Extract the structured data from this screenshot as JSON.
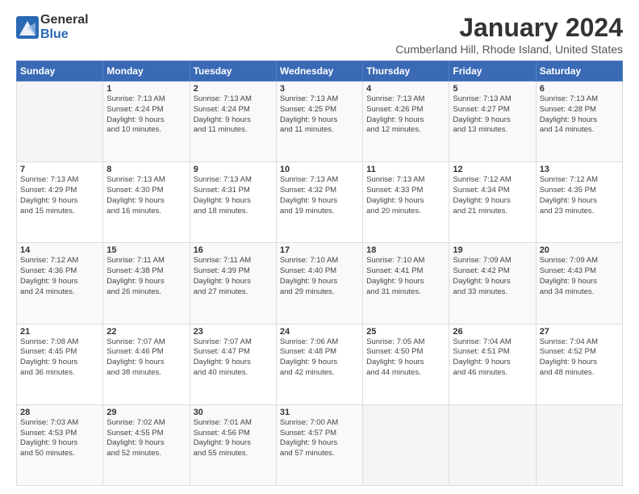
{
  "logo": {
    "general": "General",
    "blue": "Blue"
  },
  "header": {
    "title": "January 2024",
    "location": "Cumberland Hill, Rhode Island, United States"
  },
  "weekdays": [
    "Sunday",
    "Monday",
    "Tuesday",
    "Wednesday",
    "Thursday",
    "Friday",
    "Saturday"
  ],
  "weeks": [
    [
      {
        "day": "",
        "content": ""
      },
      {
        "day": "1",
        "content": "Sunrise: 7:13 AM\nSunset: 4:24 PM\nDaylight: 9 hours\nand 10 minutes."
      },
      {
        "day": "2",
        "content": "Sunrise: 7:13 AM\nSunset: 4:24 PM\nDaylight: 9 hours\nand 11 minutes."
      },
      {
        "day": "3",
        "content": "Sunrise: 7:13 AM\nSunset: 4:25 PM\nDaylight: 9 hours\nand 11 minutes."
      },
      {
        "day": "4",
        "content": "Sunrise: 7:13 AM\nSunset: 4:26 PM\nDaylight: 9 hours\nand 12 minutes."
      },
      {
        "day": "5",
        "content": "Sunrise: 7:13 AM\nSunset: 4:27 PM\nDaylight: 9 hours\nand 13 minutes."
      },
      {
        "day": "6",
        "content": "Sunrise: 7:13 AM\nSunset: 4:28 PM\nDaylight: 9 hours\nand 14 minutes."
      }
    ],
    [
      {
        "day": "7",
        "content": "Sunrise: 7:13 AM\nSunset: 4:29 PM\nDaylight: 9 hours\nand 15 minutes."
      },
      {
        "day": "8",
        "content": "Sunrise: 7:13 AM\nSunset: 4:30 PM\nDaylight: 9 hours\nand 16 minutes."
      },
      {
        "day": "9",
        "content": "Sunrise: 7:13 AM\nSunset: 4:31 PM\nDaylight: 9 hours\nand 18 minutes."
      },
      {
        "day": "10",
        "content": "Sunrise: 7:13 AM\nSunset: 4:32 PM\nDaylight: 9 hours\nand 19 minutes."
      },
      {
        "day": "11",
        "content": "Sunrise: 7:13 AM\nSunset: 4:33 PM\nDaylight: 9 hours\nand 20 minutes."
      },
      {
        "day": "12",
        "content": "Sunrise: 7:12 AM\nSunset: 4:34 PM\nDaylight: 9 hours\nand 21 minutes."
      },
      {
        "day": "13",
        "content": "Sunrise: 7:12 AM\nSunset: 4:35 PM\nDaylight: 9 hours\nand 23 minutes."
      }
    ],
    [
      {
        "day": "14",
        "content": "Sunrise: 7:12 AM\nSunset: 4:36 PM\nDaylight: 9 hours\nand 24 minutes."
      },
      {
        "day": "15",
        "content": "Sunrise: 7:11 AM\nSunset: 4:38 PM\nDaylight: 9 hours\nand 26 minutes."
      },
      {
        "day": "16",
        "content": "Sunrise: 7:11 AM\nSunset: 4:39 PM\nDaylight: 9 hours\nand 27 minutes."
      },
      {
        "day": "17",
        "content": "Sunrise: 7:10 AM\nSunset: 4:40 PM\nDaylight: 9 hours\nand 29 minutes."
      },
      {
        "day": "18",
        "content": "Sunrise: 7:10 AM\nSunset: 4:41 PM\nDaylight: 9 hours\nand 31 minutes."
      },
      {
        "day": "19",
        "content": "Sunrise: 7:09 AM\nSunset: 4:42 PM\nDaylight: 9 hours\nand 33 minutes."
      },
      {
        "day": "20",
        "content": "Sunrise: 7:09 AM\nSunset: 4:43 PM\nDaylight: 9 hours\nand 34 minutes."
      }
    ],
    [
      {
        "day": "21",
        "content": "Sunrise: 7:08 AM\nSunset: 4:45 PM\nDaylight: 9 hours\nand 36 minutes."
      },
      {
        "day": "22",
        "content": "Sunrise: 7:07 AM\nSunset: 4:46 PM\nDaylight: 9 hours\nand 38 minutes."
      },
      {
        "day": "23",
        "content": "Sunrise: 7:07 AM\nSunset: 4:47 PM\nDaylight: 9 hours\nand 40 minutes."
      },
      {
        "day": "24",
        "content": "Sunrise: 7:06 AM\nSunset: 4:48 PM\nDaylight: 9 hours\nand 42 minutes."
      },
      {
        "day": "25",
        "content": "Sunrise: 7:05 AM\nSunset: 4:50 PM\nDaylight: 9 hours\nand 44 minutes."
      },
      {
        "day": "26",
        "content": "Sunrise: 7:04 AM\nSunset: 4:51 PM\nDaylight: 9 hours\nand 46 minutes."
      },
      {
        "day": "27",
        "content": "Sunrise: 7:04 AM\nSunset: 4:52 PM\nDaylight: 9 hours\nand 48 minutes."
      }
    ],
    [
      {
        "day": "28",
        "content": "Sunrise: 7:03 AM\nSunset: 4:53 PM\nDaylight: 9 hours\nand 50 minutes."
      },
      {
        "day": "29",
        "content": "Sunrise: 7:02 AM\nSunset: 4:55 PM\nDaylight: 9 hours\nand 52 minutes."
      },
      {
        "day": "30",
        "content": "Sunrise: 7:01 AM\nSunset: 4:56 PM\nDaylight: 9 hours\nand 55 minutes."
      },
      {
        "day": "31",
        "content": "Sunrise: 7:00 AM\nSunset: 4:57 PM\nDaylight: 9 hours\nand 57 minutes."
      },
      {
        "day": "",
        "content": ""
      },
      {
        "day": "",
        "content": ""
      },
      {
        "day": "",
        "content": ""
      }
    ]
  ]
}
